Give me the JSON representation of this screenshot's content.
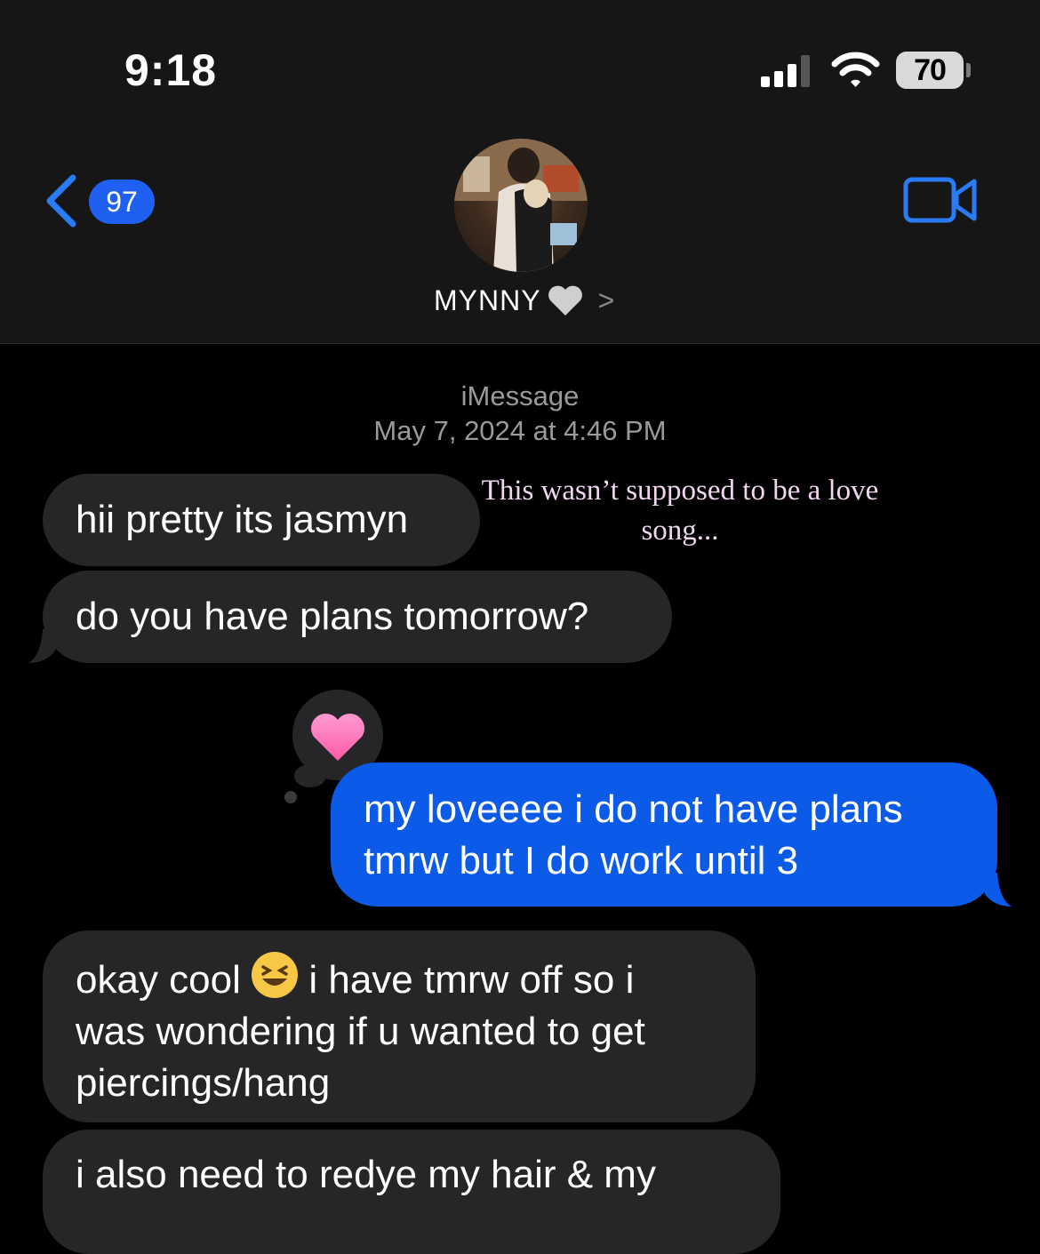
{
  "status_bar": {
    "time": "9:18",
    "battery": "70"
  },
  "nav": {
    "back_count": "97",
    "contact_name": "MYNNY",
    "contact_emoji": "grey-heart"
  },
  "conversation": {
    "service": "iMessage",
    "timestamp": "May 7, 2024 at 4:46 PM",
    "overlay_text": "This wasn’t supposed to be a love song...",
    "messages": [
      {
        "from": "them",
        "text": "hii pretty its jasmyn"
      },
      {
        "from": "them",
        "text": "do you have plans tomorrow?"
      },
      {
        "from": "me",
        "text_line1": "my loveeee i do not have plans",
        "text_line2": "tmrw but I do work until 3",
        "reaction": "pink-heart"
      },
      {
        "from": "them",
        "text_a": "okay cool",
        "text_b": "i have tmrw off so i",
        "text_line2": "was wondering if u wanted to get",
        "text_line3": "piercings/hang"
      },
      {
        "from": "them",
        "text": "i also need to redye my hair & my"
      }
    ]
  },
  "colors": {
    "incoming_bubble": "#262628",
    "outgoing_bubble": "#0b5ae8",
    "accent": "#1f60f0"
  }
}
